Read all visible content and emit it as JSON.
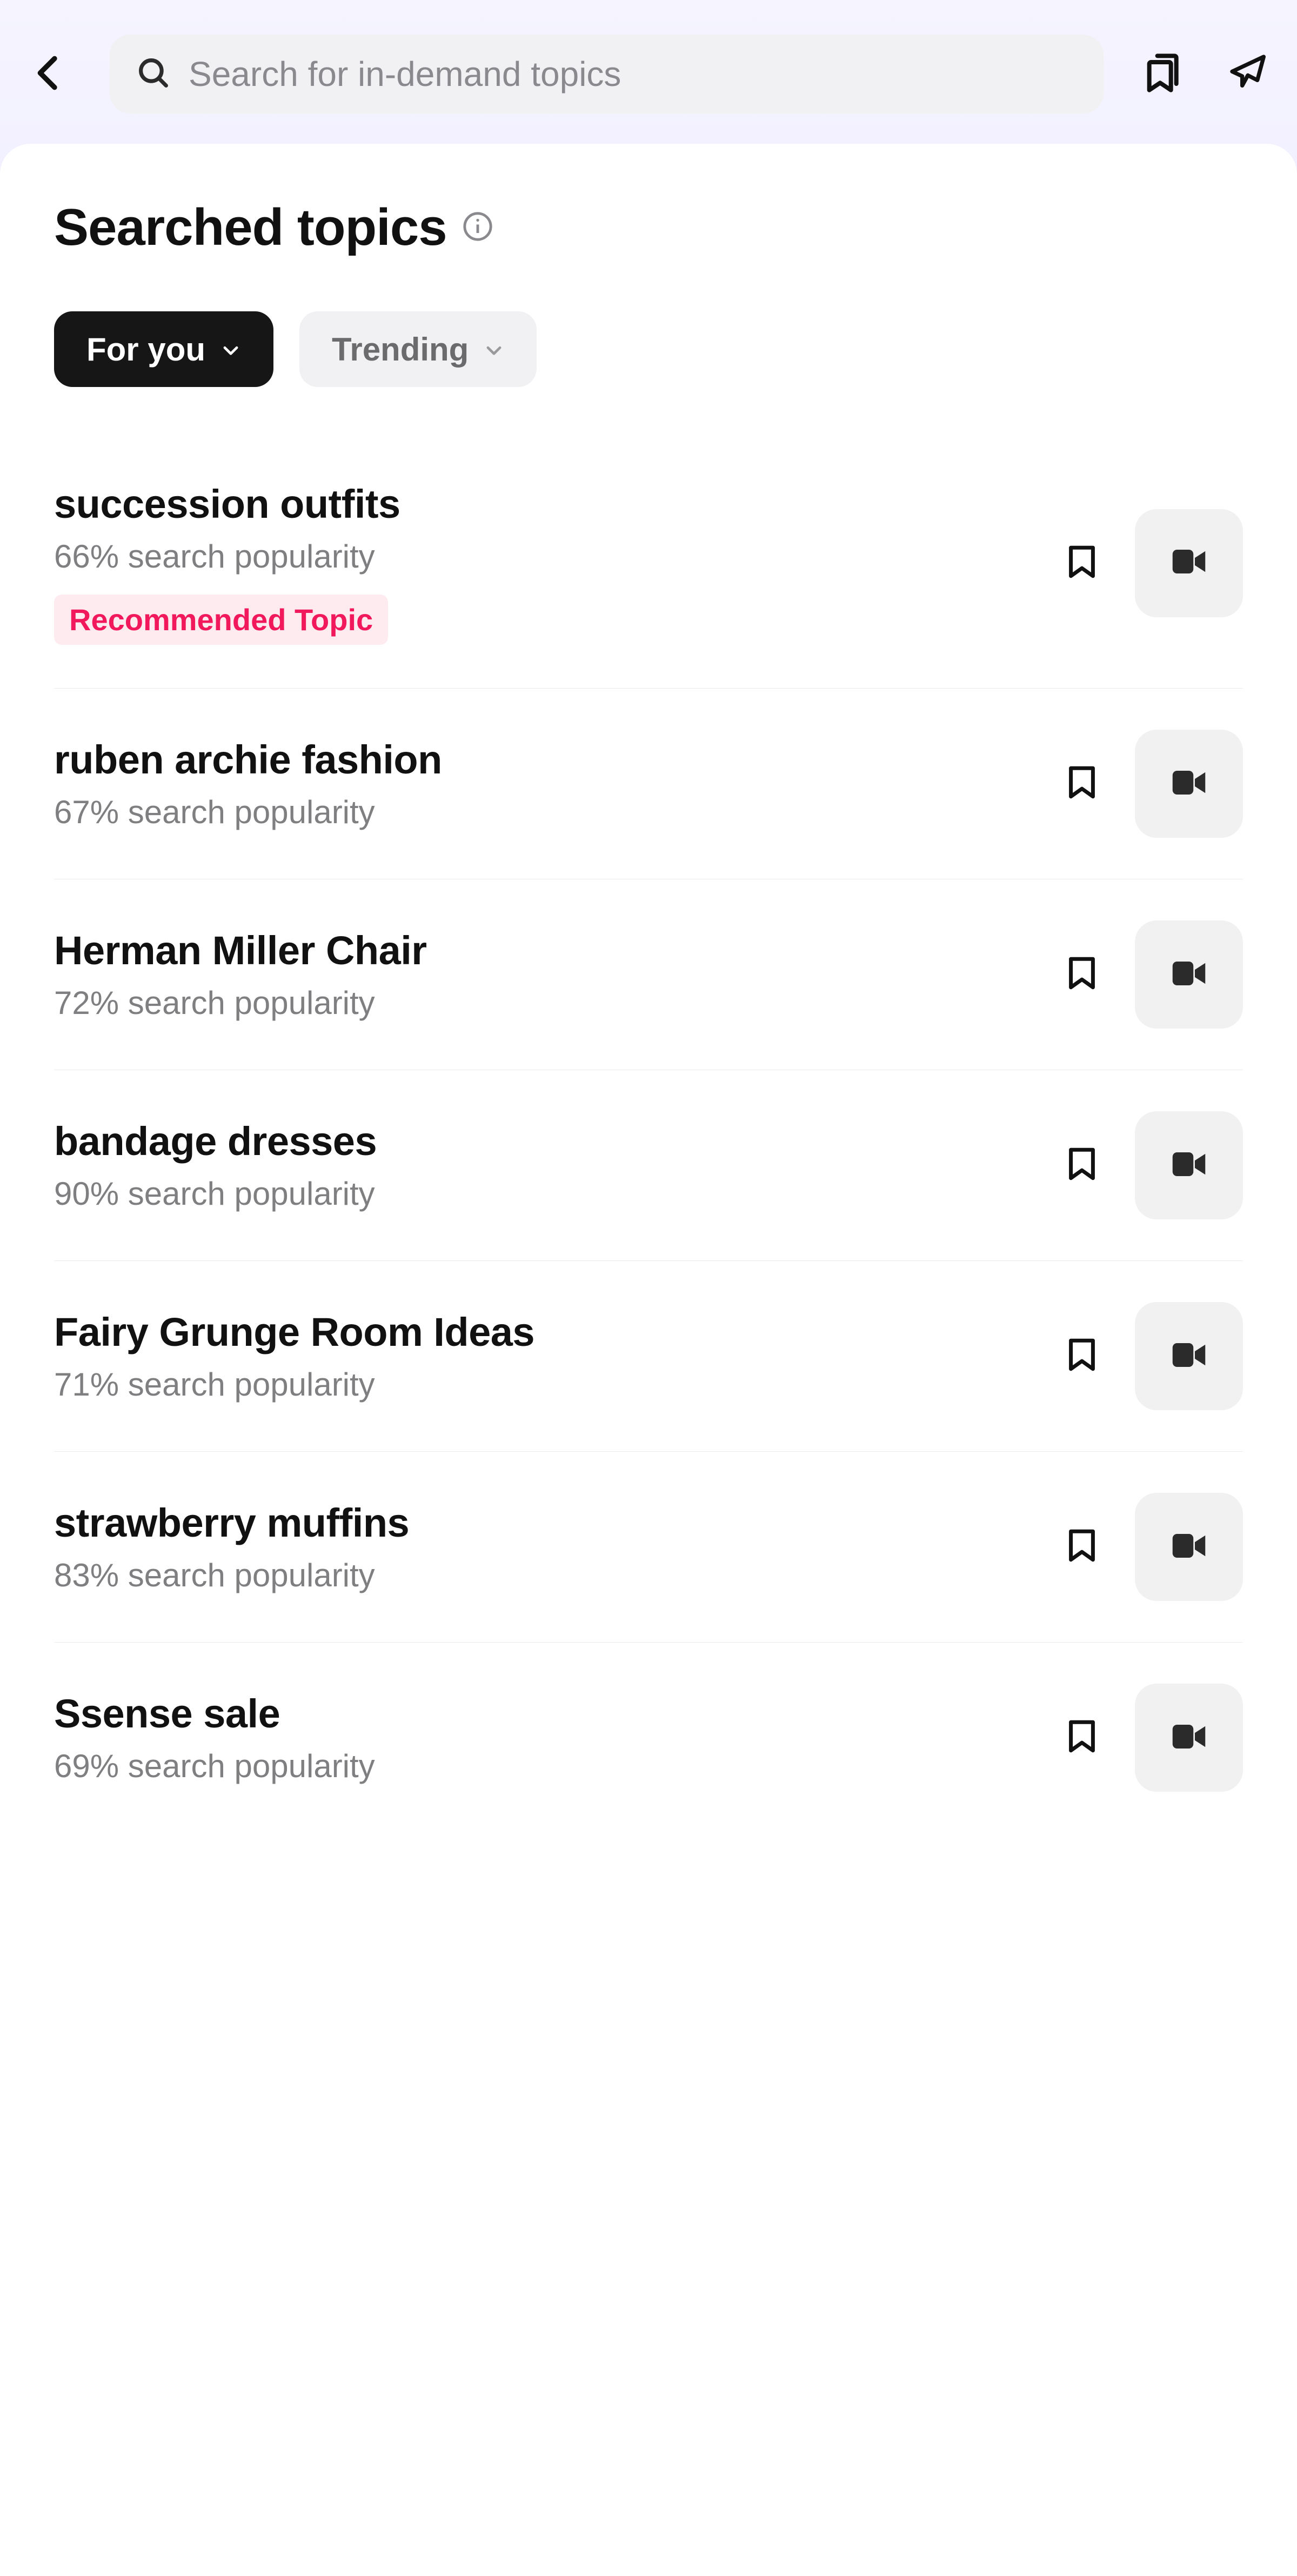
{
  "header": {
    "search_placeholder": "Search for in-demand topics"
  },
  "page": {
    "title": "Searched topics"
  },
  "filters": {
    "for_you": "For you",
    "trending": "Trending"
  },
  "labels": {
    "popularity_suffix": "% search popularity",
    "recommended_badge": "Recommended Topic"
  },
  "topics": [
    {
      "title": "succession outfits",
      "popularity": 66,
      "recommended": true
    },
    {
      "title": "ruben archie fashion",
      "popularity": 67,
      "recommended": false
    },
    {
      "title": "Herman Miller Chair",
      "popularity": 72,
      "recommended": false
    },
    {
      "title": "bandage dresses",
      "popularity": 90,
      "recommended": false
    },
    {
      "title": "Fairy Grunge Room Ideas",
      "popularity": 71,
      "recommended": false
    },
    {
      "title": "strawberry muffins",
      "popularity": 83,
      "recommended": false
    },
    {
      "title": "Ssense sale",
      "popularity": 69,
      "recommended": false
    }
  ]
}
